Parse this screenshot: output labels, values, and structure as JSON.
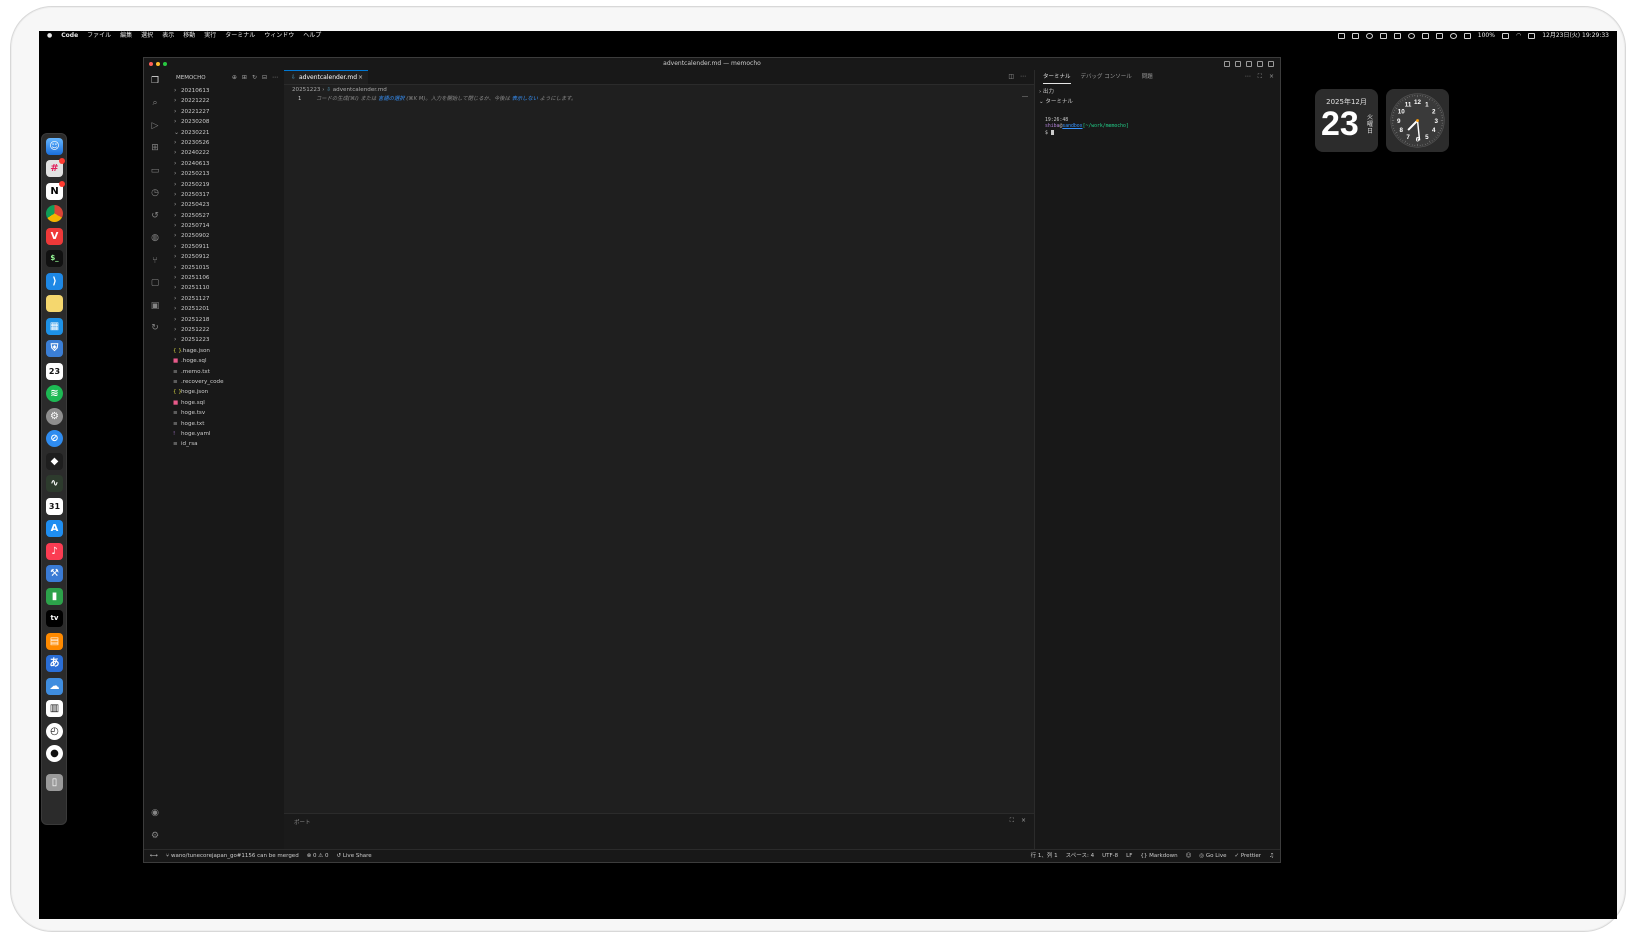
{
  "menubar": {
    "app": "Code",
    "items": [
      "ファイル",
      "編集",
      "選択",
      "表示",
      "移動",
      "実行",
      "ターミナル",
      "ウィンドウ",
      "ヘルプ"
    ],
    "battery": "100%",
    "datetime": "12月23日(火) 19:29:33"
  },
  "window": {
    "title": "adventcalender.md — memocho"
  },
  "explorer": {
    "title": "MEMOCHO",
    "folders": [
      "20210613",
      "20221222",
      "20221227",
      "20230208",
      "20230221",
      "20230526",
      "20240222",
      "20240613",
      "20250213",
      "20250219",
      "20250317",
      "20250423",
      "20250527",
      "20250714",
      "20250902",
      "20250911",
      "20250912",
      "20251015",
      "20251106",
      "20251110",
      "20251127",
      "20251201",
      "20251218",
      "20251222",
      "20251223"
    ],
    "files": [
      {
        "name": ".hage.json",
        "icon": "{ }",
        "color": "#cbcb41"
      },
      {
        "name": ".hoge.sql",
        "icon": "■",
        "color": "#e85a8a"
      },
      {
        "name": ".memo.txt",
        "icon": "≡",
        "color": "#a0a0a0"
      },
      {
        "name": ".recovery_code",
        "icon": "≡",
        "color": "#a0a0a0"
      },
      {
        "name": "hoge.json",
        "icon": "{ }",
        "color": "#cbcb41"
      },
      {
        "name": "hoge.sql",
        "icon": "■",
        "color": "#e85a8a"
      },
      {
        "name": "hoge.tsv",
        "icon": "≡",
        "color": "#a0a0a0"
      },
      {
        "name": "hoge.txt",
        "icon": "≡",
        "color": "#a0a0a0"
      },
      {
        "name": "hoge.yaml",
        "icon": "!",
        "color": "#a074c4"
      },
      {
        "name": "id_rsa",
        "icon": "≡",
        "color": "#a0a0a0"
      }
    ]
  },
  "editor": {
    "tab_label": "adventcalender.md",
    "breadcrumb_folder": "20251223",
    "breadcrumb_file": "adventcalender.md",
    "line_number": "1",
    "hint_prefix": "コードの生成(⌘I) または",
    "hint_link1": "言語の選択",
    "hint_middle": "(⌘K M)。入力を開始して閉じるか、今後は",
    "hint_link2": "表示しない",
    "hint_suffix": "ようにします。",
    "panel_title": "ポート"
  },
  "aux": {
    "tabs": [
      "ターミナル",
      "デバッグ コンソール",
      "問題"
    ],
    "output_label": "出力",
    "terminal_label": "ターミナル",
    "terminal_time": "19:26:48",
    "terminal_user": "shiba",
    "terminal_at": "@",
    "terminal_host": "sandbox",
    "terminal_path": "[~/work/memocho]",
    "terminal_prompt": "$"
  },
  "statusbar": {
    "branch": "wano/tunecorejapan_go#1156 can be merged",
    "problems": "⊗ 0 ⚠ 0",
    "liveshare": "Live Share",
    "position": "行 1、列 1",
    "spaces": "スペース: 4",
    "encoding": "UTF-8",
    "eol": "LF",
    "language": "Markdown",
    "golive": "Go Live",
    "prettier": "✓ Prettier"
  },
  "widgets": {
    "calendar_month": "2025年12月",
    "calendar_day": "23",
    "calendar_dow": "火曜日",
    "clock_numbers": [
      "12",
      "1",
      "2",
      "3",
      "4",
      "5",
      "6",
      "7",
      "8",
      "9",
      "10",
      "11"
    ],
    "clock_hour": 7,
    "clock_minute": 29
  },
  "dock": {
    "calendar_icon_text": "23",
    "calendar_app_text": "31",
    "tv_text": "tv",
    "ime_text": "あ"
  },
  "colors": {
    "accent": "#0078d4",
    "window_bg": "#1f1f1f",
    "sidebar_bg": "#181818"
  }
}
